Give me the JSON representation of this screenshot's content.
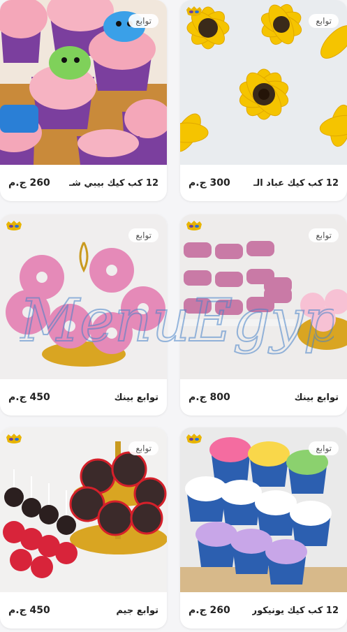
{
  "products": [
    {
      "id": "p1",
      "title": "12 كب كيك عباد الـ",
      "price": "300 ج.م",
      "tag": "توابع"
    },
    {
      "id": "p2",
      "title": "12 كب كيك بيبي شـ",
      "price": "260 ج.م",
      "tag": "توابع"
    },
    {
      "id": "p3",
      "title": "توابع بينك",
      "price": "800 ج.م",
      "tag": "توابع"
    },
    {
      "id": "p4",
      "title": "توابع بينك",
      "price": "450 ج.م",
      "tag": "توابع"
    },
    {
      "id": "p5",
      "title": "12 كب كيك يونيكور",
      "price": "260 ج.م",
      "tag": "توابع"
    },
    {
      "id": "p6",
      "title": "توابع جيم",
      "price": "450 ج.م",
      "tag": "توابع"
    }
  ],
  "watermark": "MenuEgypt.com",
  "colors": {
    "mask_gold": "#e8b400",
    "mask_purple": "#6b3fa0",
    "mask_blue": "#2a6fd6"
  }
}
